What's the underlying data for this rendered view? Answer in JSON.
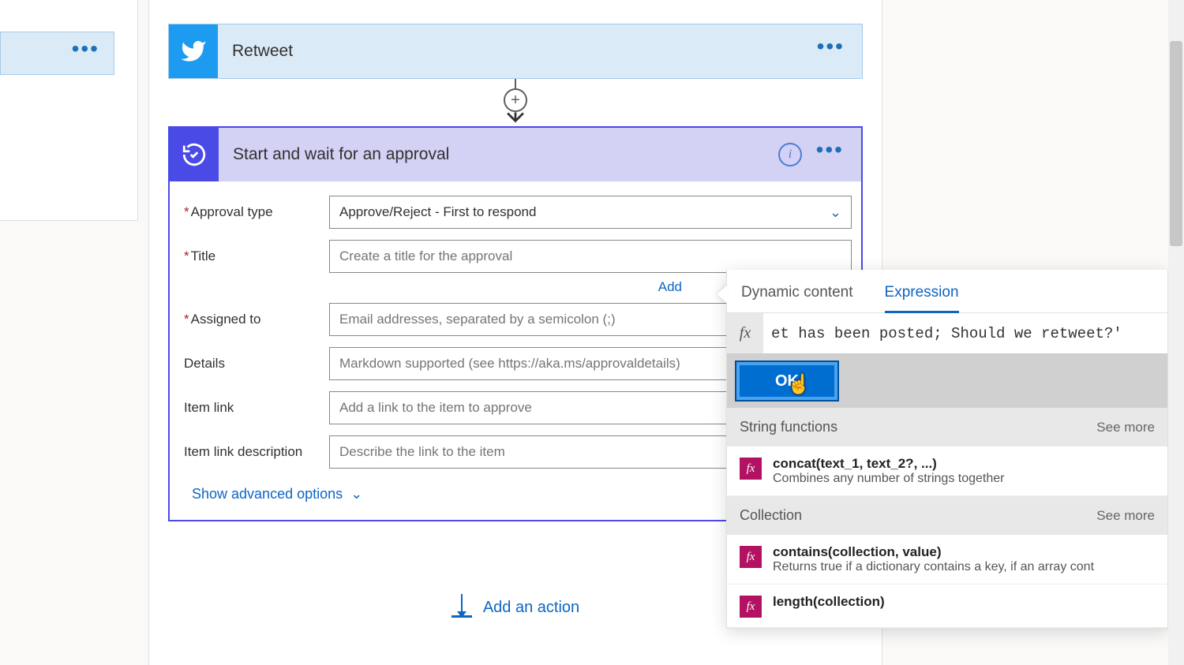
{
  "left_partial": {
    "menu": "•••"
  },
  "retweet_card": {
    "title": "Retweet",
    "menu": "•••"
  },
  "approval_card": {
    "title": "Start and wait for an approval",
    "info": "i",
    "menu": "•••",
    "fields": {
      "approval_type": {
        "label": "Approval type",
        "value": "Approve/Reject - First to respond"
      },
      "title": {
        "label": "Title",
        "placeholder": "Create a title for the approval"
      },
      "add_link": "Add",
      "assigned_to": {
        "label": "Assigned to",
        "placeholder": "Email addresses, separated by a semicolon (;)"
      },
      "details": {
        "label": "Details",
        "placeholder": "Markdown supported (see https://aka.ms/approvaldetails)"
      },
      "item_link": {
        "label": "Item link",
        "placeholder": "Add a link to the item to approve"
      },
      "item_link_desc": {
        "label": "Item link description",
        "placeholder": "Describe the link to the item"
      }
    },
    "show_advanced": "Show advanced options"
  },
  "add_action": "Add an action",
  "flyout": {
    "tabs": {
      "dynamic": "Dynamic content",
      "expression": "Expression"
    },
    "fx": "fx",
    "expression_value": "et has been posted; Should we retweet?'",
    "ok": "OK",
    "sections": [
      {
        "name": "String functions",
        "see_more": "See more",
        "items": [
          {
            "sig": "concat(text_1, text_2?, ...)",
            "desc": "Combines any number of strings together"
          }
        ]
      },
      {
        "name": "Collection",
        "see_more": "See more",
        "items": [
          {
            "sig": "contains(collection, value)",
            "desc": "Returns true if a dictionary contains a key, if an array cont"
          },
          {
            "sig": "length(collection)",
            "desc": ""
          }
        ]
      }
    ]
  }
}
